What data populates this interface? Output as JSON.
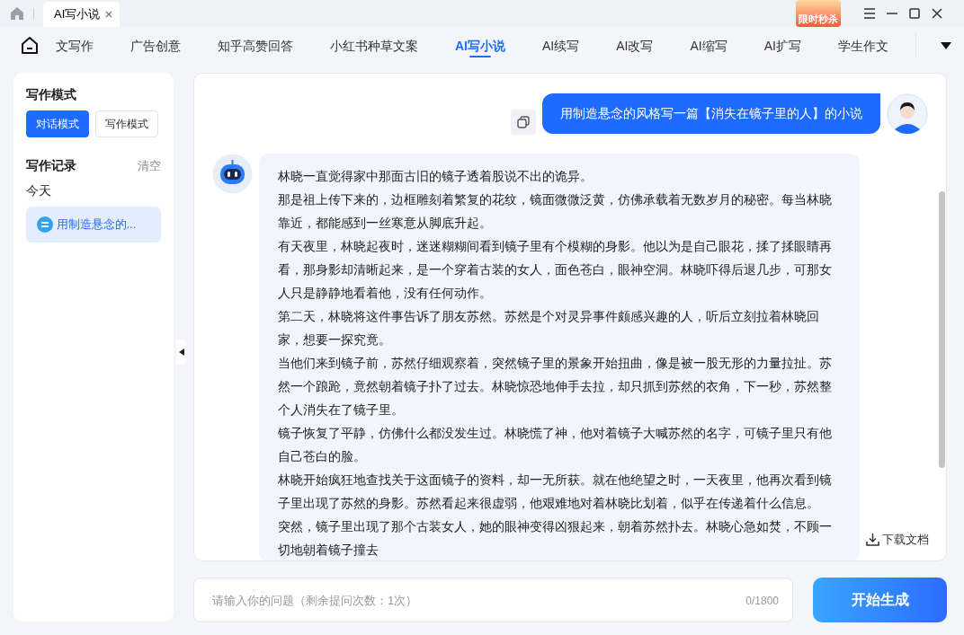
{
  "title_bar": {
    "tabs": [
      {
        "label": "AI写小说",
        "selected": true
      }
    ],
    "promo": "限时秒杀"
  },
  "nav_tabs": [
    {
      "label": "文写作",
      "selected": false
    },
    {
      "label": "广告创意",
      "selected": false
    },
    {
      "label": "知乎高赞回答",
      "selected": false
    },
    {
      "label": "小红书种草文案",
      "selected": false
    },
    {
      "label": "AI写小说",
      "selected": true
    },
    {
      "label": "AI续写",
      "selected": false
    },
    {
      "label": "AI改写",
      "selected": false
    },
    {
      "label": "AI缩写",
      "selected": false
    },
    {
      "label": "AI扩写",
      "selected": false
    },
    {
      "label": "学生作文",
      "selected": false
    }
  ],
  "sidebar": {
    "mode_title": "写作模式",
    "modes": [
      {
        "label": "对话模式",
        "selected": true
      },
      {
        "label": "写作模式",
        "selected": false
      }
    ],
    "history_title": "写作记录",
    "clear": "清空",
    "groups": [
      {
        "label": "今天",
        "items": [
          {
            "label": "用制造悬念的...",
            "selected": true
          }
        ]
      }
    ]
  },
  "chat": {
    "messages": [
      {
        "kind": "user",
        "text": "用制造悬念的风格写一篇【消失在镜子里的人】的小说"
      },
      {
        "kind": "assistant",
        "paragraphs": [
          "林晓一直觉得家中那面古旧的镜子透着股说不出的诡异。",
          "那是祖上传下来的，边框雕刻着繁复的花纹，镜面微微泛黄，仿佛承载着无数岁月的秘密。每当林晓靠近，都能感到一丝寒意从脚底升起。",
          "有天夜里，林晓起夜时，迷迷糊糊间看到镜子里有个模糊的身影。他以为是自己眼花，揉了揉眼睛再看，那身影却清晰起来，是一个穿着古装的女人，面色苍白，眼神空洞。林晓吓得后退几步，可那女人只是静静地看着他，没有任何动作。",
          "第二天，林晓将这件事告诉了朋友苏然。苏然是个对灵异事件颇感兴趣的人，听后立刻拉着林晓回家，想要一探究竟。",
          "当他们来到镜子前，苏然仔细观察着，突然镜子里的景象开始扭曲，像是被一股无形的力量拉扯。苏然一个踉跄，竟然朝着镜子扑了过去。林晓惊恐地伸手去拉，却只抓到苏然的衣角，下一秒，苏然整个人消失在了镜子里。",
          "镜子恢复了平静，仿佛什么都没发生过。林晓慌了神，他对着镜子大喊苏然的名字，可镜子里只有他自己苍白的脸。",
          "林晓开始疯狂地查找关于这面镜子的资料，却一无所获。就在他绝望之时，一天夜里，他再次看到镜子里出现了苏然的身影。苏然看起来很虚弱，他艰难地对着林晓比划着，似乎在传递着什么信息。",
          "突然，镜子里出现了那个古装女人，她的眼神变得凶狠起来，朝着苏然扑去。林晓心急如焚，不顾一切地朝着镜子撞去"
        ]
      }
    ],
    "download": "下载文档"
  },
  "input": {
    "placeholder": "请输入你的问题（剩余提问次数：1次）",
    "counter": "0/1800"
  },
  "generate_button": "开始生成"
}
